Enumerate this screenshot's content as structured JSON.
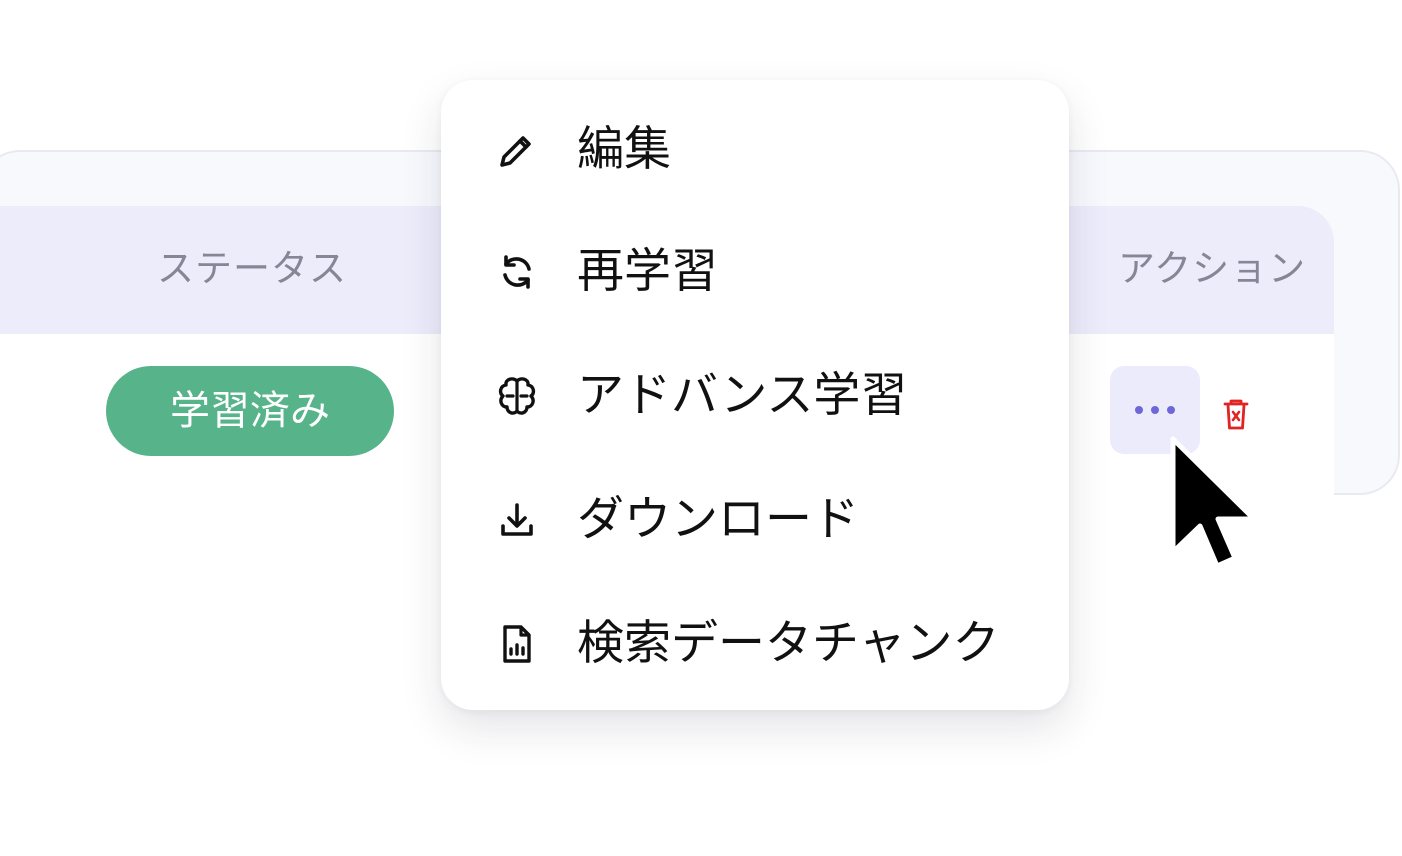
{
  "table": {
    "headers": {
      "status": "ステータス",
      "action": "アクション"
    },
    "rows": [
      {
        "status_badge": "学習済み",
        "status_color": "#56b38a"
      }
    ],
    "accent_color": "#edecfb",
    "more_icon": "more-horizontal-icon",
    "delete_icon": "trash-icon",
    "delete_color": "#e02424"
  },
  "menu": {
    "items": [
      {
        "label": "編集",
        "icon": "pencil-icon"
      },
      {
        "label": "再学習",
        "icon": "refresh-icon"
      },
      {
        "label": "アドバンス学習",
        "icon": "brain-icon"
      },
      {
        "label": "ダウンロード",
        "icon": "download-icon"
      },
      {
        "label": "検索データチャンク",
        "icon": "file-chart-icon"
      }
    ]
  }
}
